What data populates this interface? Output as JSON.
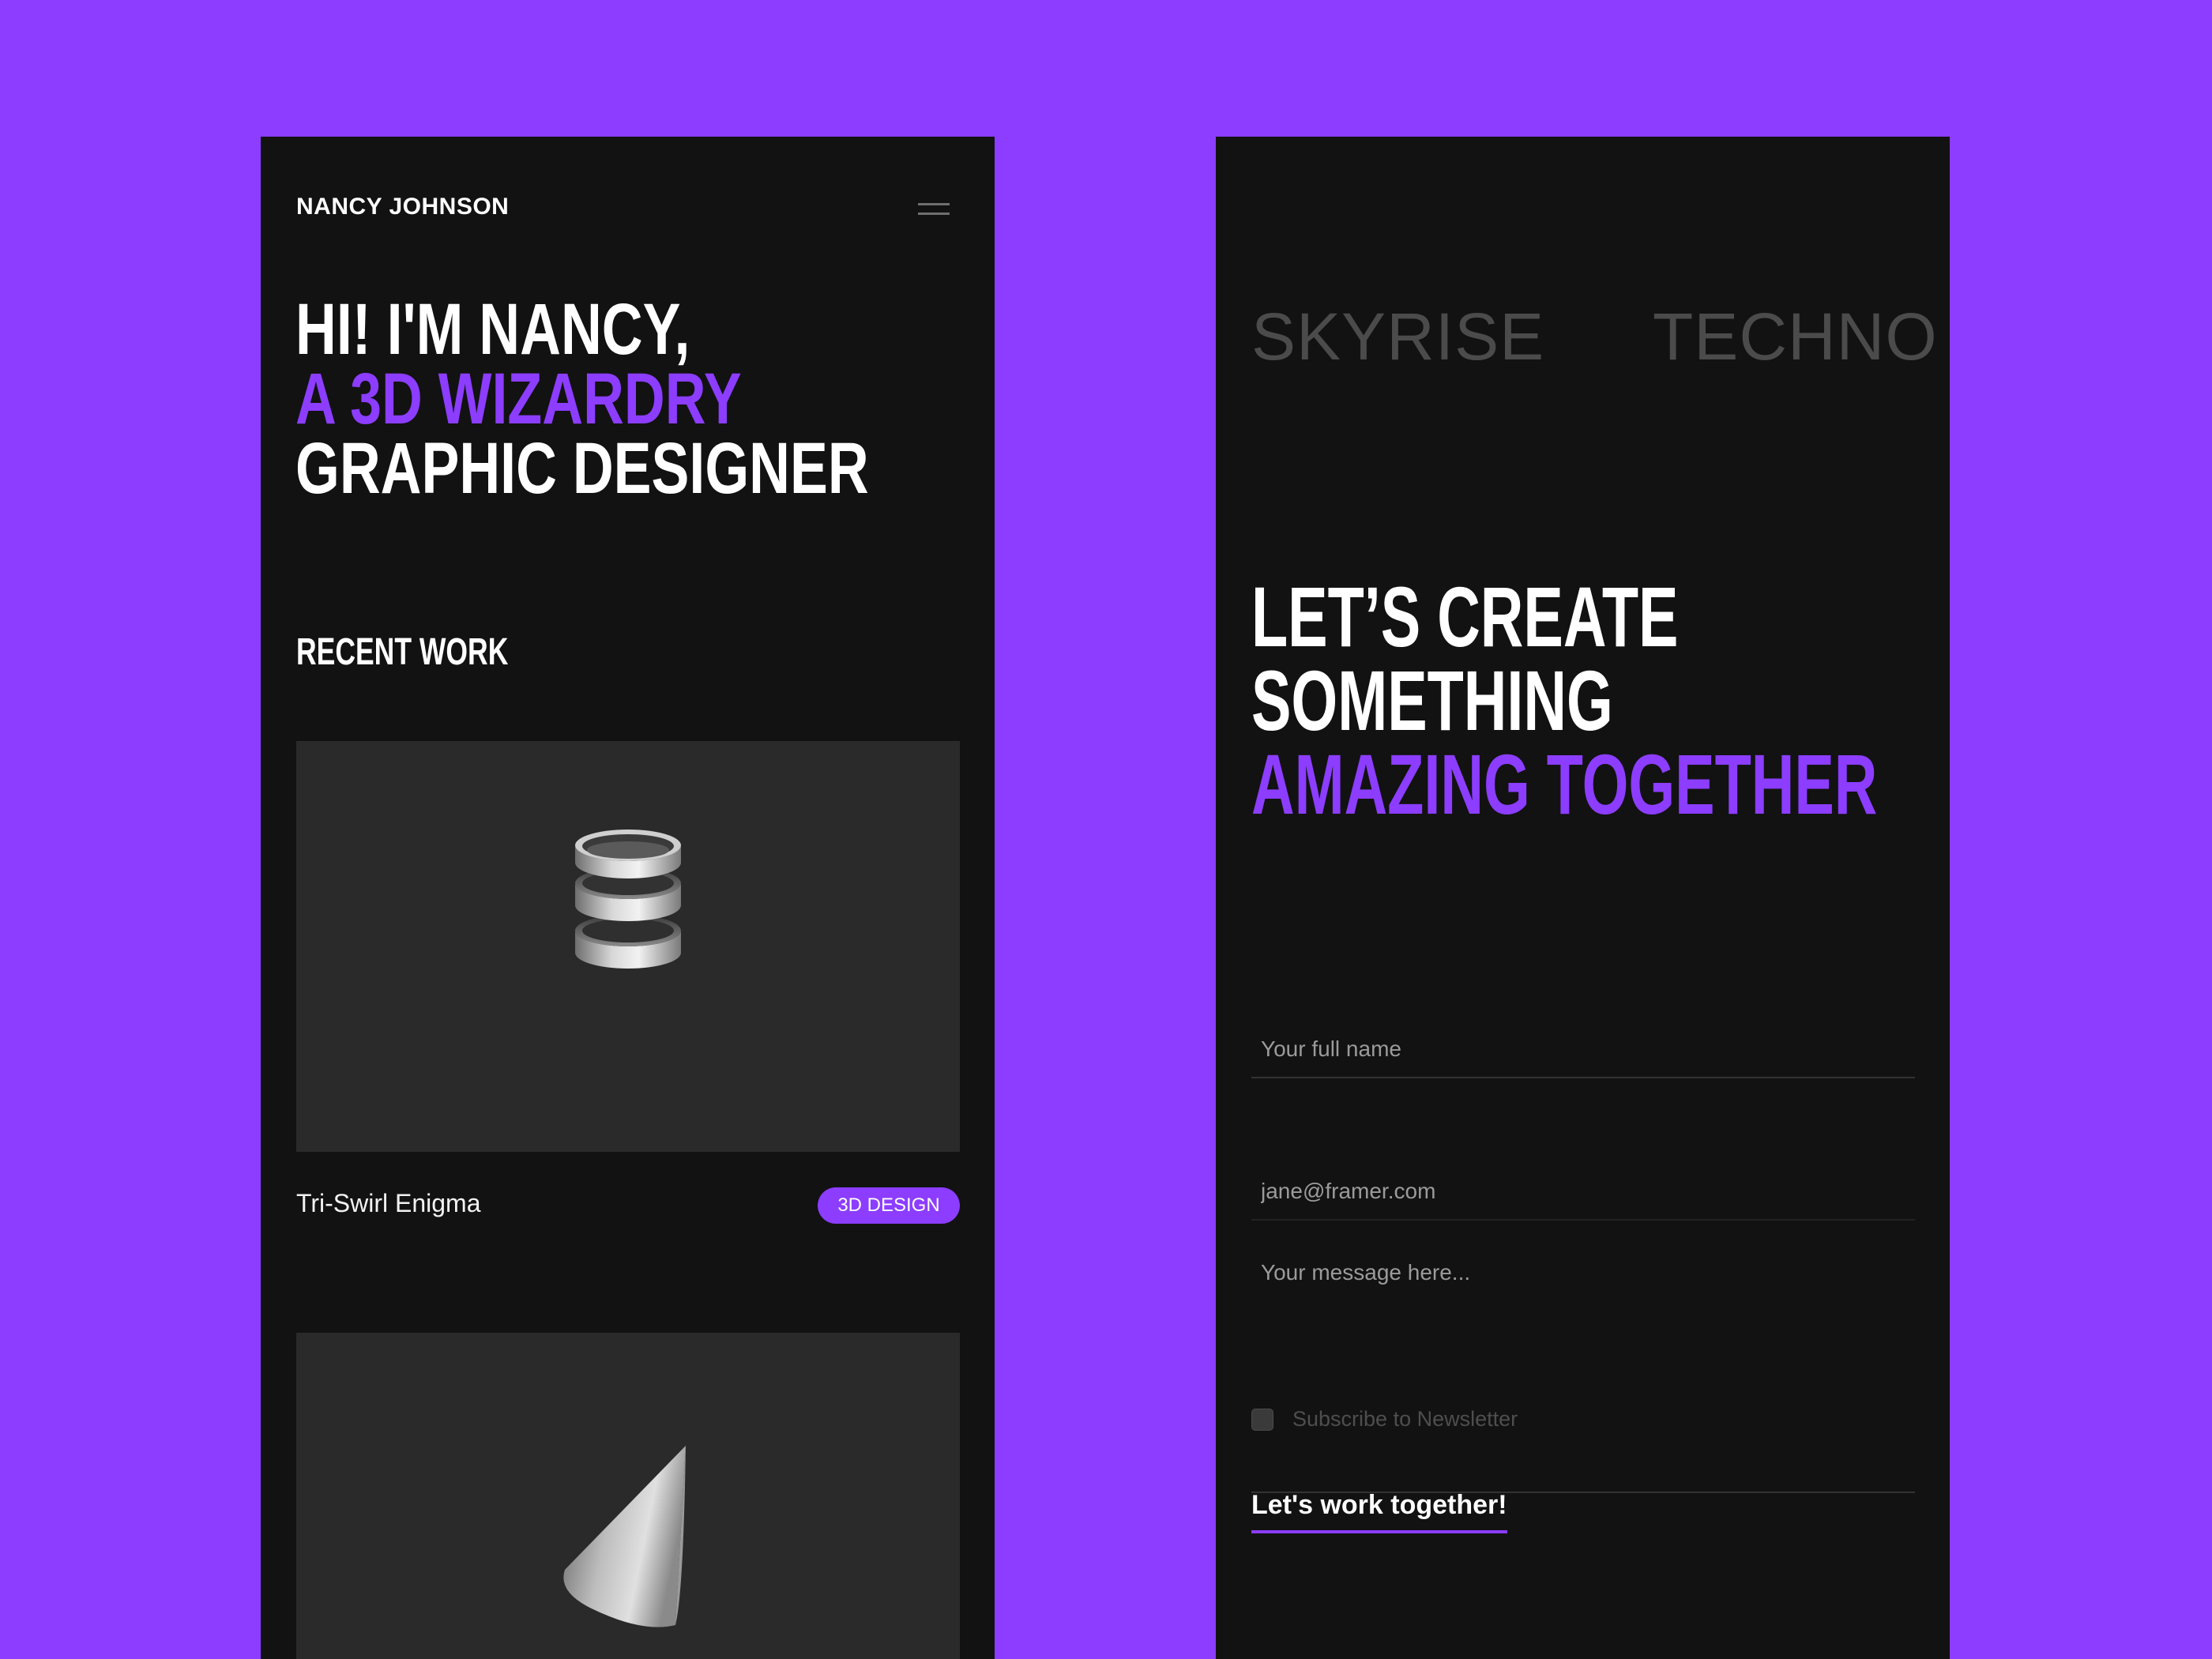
{
  "colors": {
    "background": "#8c3dff",
    "panel": "#121212",
    "accent": "#8c3dff",
    "card": "#2a2a2a"
  },
  "home": {
    "brand": "NANCY JOHNSON",
    "menu_icon": "hamburger-menu-icon",
    "hero": {
      "line1": "HI! I'M NANCY,",
      "line2": "A 3D WIZARDRY",
      "line3": "GRAPHIC DESIGNER"
    },
    "recent_work_title": "RECENT WORK",
    "works": [
      {
        "title": "Tri-Swirl Enigma",
        "tag": "3D DESIGN",
        "image": "triple-ring-stack-render"
      },
      {
        "image": "cone-render"
      }
    ]
  },
  "contact": {
    "marquee": [
      "SKYRISE",
      "TECHNO"
    ],
    "heading": {
      "line1": "LET’S CREATE",
      "line2": "SOMETHING",
      "line3": "AMAZING TOGETHER"
    },
    "form": {
      "name_placeholder": "Your full name",
      "email_placeholder": "jane@framer.com",
      "message_placeholder": "Your message here...",
      "newsletter_label": "Subscribe to Newsletter",
      "newsletter_checked": false,
      "submit_label": "Let's work together!"
    }
  }
}
